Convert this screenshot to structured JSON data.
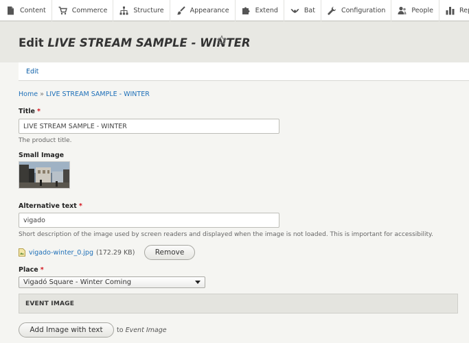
{
  "toolbar": {
    "items": [
      {
        "label": "Content",
        "icon": "page-icon"
      },
      {
        "label": "Commerce",
        "icon": "cart-icon"
      },
      {
        "label": "Structure",
        "icon": "sitemap-icon"
      },
      {
        "label": "Appearance",
        "icon": "brush-icon"
      },
      {
        "label": "Extend",
        "icon": "puzzle-icon"
      },
      {
        "label": "Bat",
        "icon": "bat-icon"
      },
      {
        "label": "Configuration",
        "icon": "wrench-icon"
      },
      {
        "label": "People",
        "icon": "people-icon"
      },
      {
        "label": "Reports",
        "icon": "bar-chart-icon"
      }
    ]
  },
  "header": {
    "title_prefix": "Edit",
    "title_name": "LIVE STREAM SAMPLE - WINTER"
  },
  "tabs": [
    {
      "label": "Edit",
      "active": true
    }
  ],
  "breadcrumb": {
    "home": "Home",
    "separator": "»",
    "current": "LIVE STREAM SAMPLE - WINTER"
  },
  "form": {
    "title_label": "Title",
    "required_marker": "*",
    "title_value": "LIVE STREAM SAMPLE - WINTER",
    "title_desc": "The product title.",
    "small_image_label": "Small Image",
    "alt_label": "Alternative text",
    "alt_value": "vigado",
    "alt_desc": "Short description of the image used by screen readers and displayed when the image is not loaded. This is important for accessibility.",
    "file_name": "vigado-winter_0.jpg",
    "file_size": "(172.29 KB)",
    "remove_label": "Remove",
    "place_label": "Place",
    "place_selected": "Vigadó Square - Winter Coming",
    "event_image_legend": "EVENT IMAGE",
    "add_image_label": "Add Image with text",
    "to_text": "to",
    "to_target": "Event Image"
  },
  "colors": {
    "link": "#1d6fb8",
    "required": "#d3161f",
    "header_bg": "#e8e8e3"
  }
}
